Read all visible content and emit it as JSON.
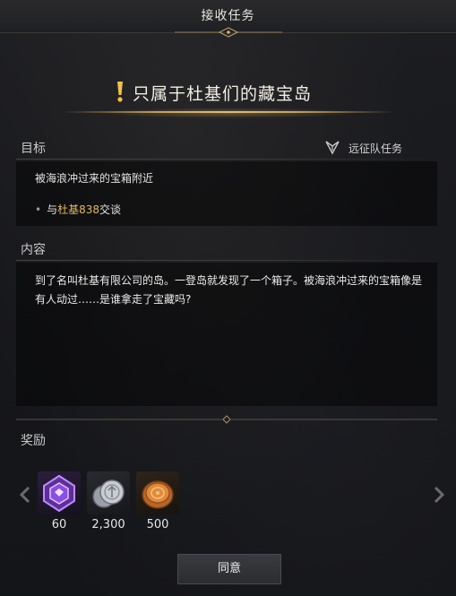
{
  "header": {
    "title": "接收任务"
  },
  "quest": {
    "title": "只属于杜基们的藏宝岛"
  },
  "goal": {
    "label": "目标",
    "type_label": "远征队任务",
    "description": "被海浪冲过来的宝箱附近",
    "task": {
      "bullet": "•",
      "prefix": "与",
      "npc": "杜基838",
      "suffix": "交谈"
    }
  },
  "content": {
    "label": "内容",
    "text": "到了名叫杜基有限公司的岛。一登岛就发现了一个箱子。被海浪冲过来的宝箱像是有人动过……是谁拿走了宝藏吗?"
  },
  "rewards": {
    "label": "奖励",
    "items": [
      {
        "icon": "purple-crystal-icon",
        "count": "60"
      },
      {
        "icon": "silver-coins-icon",
        "count": "2,300"
      },
      {
        "icon": "gold-coins-icon",
        "count": "500"
      }
    ]
  },
  "buttons": {
    "agree": "同意"
  },
  "colors": {
    "accent_gold": "#e0bd73",
    "npc_highlight": "#e0b862",
    "background": "#17181c"
  }
}
